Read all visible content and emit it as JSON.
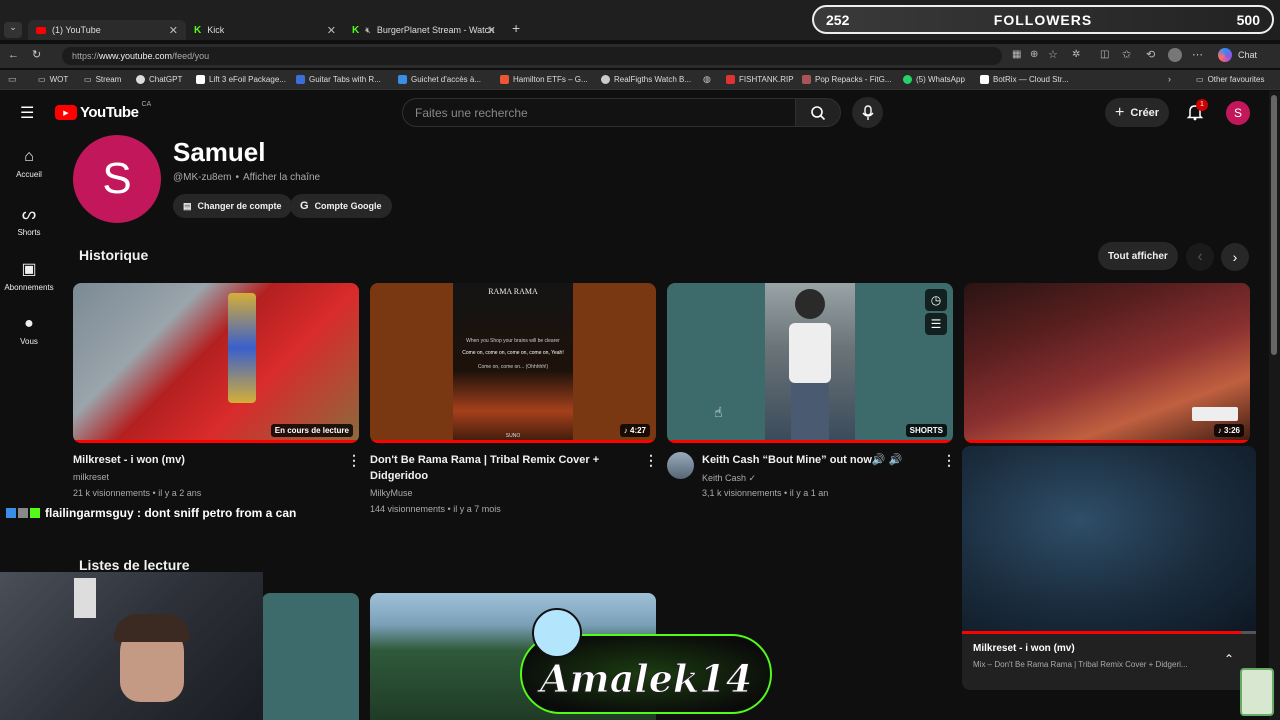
{
  "browser": {
    "tabs": [
      {
        "label": "(1) YouTube",
        "active": true
      },
      {
        "label": "Kick",
        "active": false
      },
      {
        "label": "BurgerPlanet Stream - Watch",
        "active": false
      }
    ],
    "url": "https://www.youtube.com/feed/you",
    "url_domain": "www.youtube.com",
    "url_path": "/feed/you",
    "chat_label": "Chat",
    "bookmarks": [
      "WOT",
      "Stream",
      "ChatGPT",
      "Lift 3 eFoil Package...",
      "Guitar Tabs with R...",
      "Guichet d'accès à...",
      "Hamilton ETFs – G...",
      "RealFigths Watch B...",
      "FISHTANK.RIP",
      "Pop Repacks - FitG...",
      "(5) WhatsApp",
      "BotRix — Cloud Str..."
    ],
    "other_favourites": "Other favourites"
  },
  "overlay": {
    "followers_current": "252",
    "followers_label": "FOLLOWERS",
    "followers_goal": "500",
    "followers_progress": 0.504,
    "chat_message": "flailingarmsguy : dont sniff petro from a can",
    "logo_text": "Amalek14"
  },
  "youtube": {
    "logo": "YouTube",
    "region": "CA",
    "search_placeholder": "Faites une recherche",
    "create_label": "Créer",
    "notif_count": "1",
    "avatar_letter": "S",
    "sidebar": [
      {
        "label": "Accueil",
        "icon": "home-icon"
      },
      {
        "label": "Shorts",
        "icon": "shorts-icon"
      },
      {
        "label": "Abonnements",
        "icon": "subscriptions-icon"
      },
      {
        "label": "Vous",
        "icon": "you-icon"
      }
    ],
    "profile": {
      "name": "Samuel",
      "handle": "@MK-zu8em",
      "separator": "•",
      "view_channel": "Afficher la chaîne",
      "switch_account": "Changer de compte",
      "google_account": "Compte Google"
    },
    "history": {
      "title": "Historique",
      "see_all": "Tout afficher",
      "videos": [
        {
          "title": "Milkreset - i won (mv)",
          "channel": "milkreset",
          "views": "21 k visionnements",
          "age": "il y a 2 ans",
          "badge": "En cours de lecture",
          "progress": 1.0
        },
        {
          "title": "Don't Be Rama Rama | Tribal Remix Cover + Didgeridoo",
          "channel": "MilkyMuse",
          "views": "144 visionnements",
          "age": "il y a 7 mois",
          "badge": "♪ 4:27",
          "progress": 1.0,
          "thumb_title": "RAMA RAMA",
          "thumb_lyric1": "When you Shop your brains will be clearer",
          "thumb_lyric2": "Come on, come on, come on, come on, Yeah!",
          "thumb_lyric3": "Come on, come on... (Ohhhhh!)",
          "thumb_footer": "SUNO"
        },
        {
          "title": "Keith Cash “Bout Mine” out now🔊 🔊",
          "channel": "Keith Cash",
          "views": "3,1 k visionnements",
          "age": "il y a 1 an",
          "badge": "SHORTS",
          "progress": 1.0
        },
        {
          "title": "",
          "badge": "♪ 3:26",
          "progress": 1.0
        }
      ]
    },
    "playlists": {
      "title": "Listes de lecture"
    },
    "miniplayer": {
      "title": "Milkreset - i won (mv)",
      "subtitle": "Mix – Don't Be Rama Rama | Tribal Remix Cover + Didgeri...",
      "progress": 0.95
    }
  },
  "colors": {
    "accent": "#ff0000",
    "avatar": "#c2185b",
    "kick": "#53fc18"
  }
}
